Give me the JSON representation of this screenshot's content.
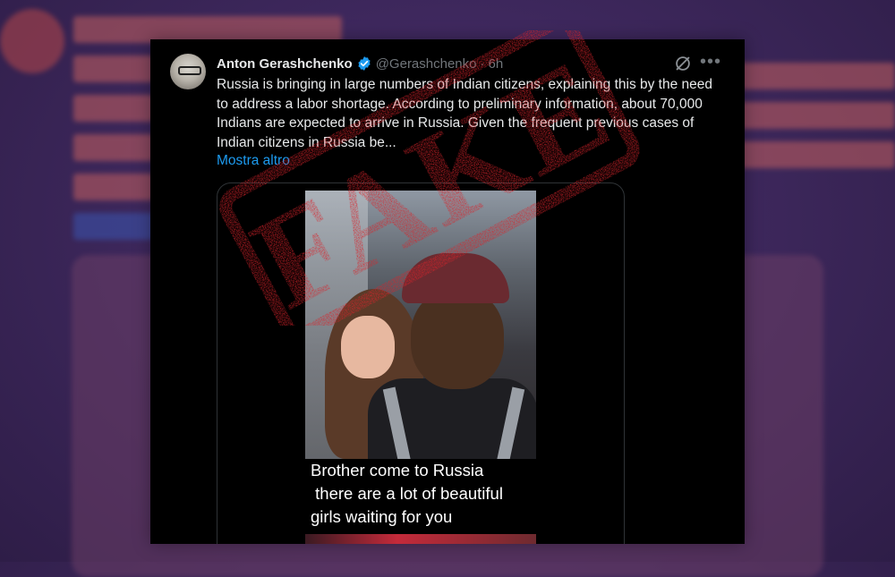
{
  "tweet": {
    "author_name": "Anton Gerashchenko",
    "handle": "@Gerashchenko",
    "time": "6h",
    "text": "Russia is bringing in large numbers of Indian citizens, explaining this by the need to address a labor shortage. According to preliminary information, about 70,000 Indians are expected to arrive in Russia. Given the frequent previous cases of Indian citizens in Russia be...",
    "show_more_label": "Mostra altro"
  },
  "media": {
    "caption": "Brother come to Russia\n there are a lot of beautiful\ngirls waiting for you"
  },
  "stamp": {
    "text": "FAKE"
  },
  "colors": {
    "background": "#3b2659",
    "card": "#000000",
    "link": "#1d9bf0",
    "verified": "#1d9bf0",
    "stamp": "#d8232a",
    "secondary_text": "#71767b"
  },
  "icons": [
    "verified-badge-icon",
    "grok-icon",
    "more-options-icon"
  ]
}
